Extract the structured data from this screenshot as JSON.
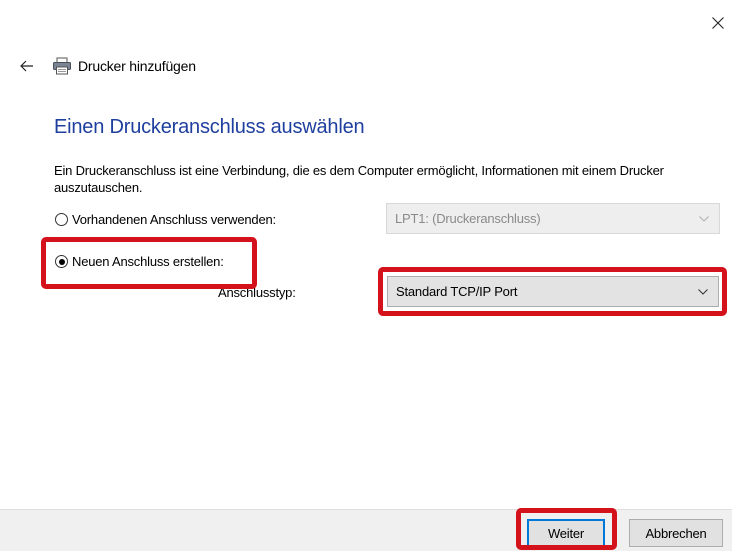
{
  "header": {
    "close_icon": "close-icon",
    "back_icon": "back-arrow-icon",
    "printer_icon": "printer-icon",
    "title": "Drucker hinzufügen"
  },
  "main": {
    "page_title": "Einen Druckeranschluss auswählen",
    "description": "Ein Druckeranschluss ist eine Verbindung, die es dem Computer ermöglicht, Informationen mit einem Drucker auszutauschen.",
    "existing_port": {
      "label": "Vorhandenen Anschluss verwenden:",
      "selected": false,
      "value": "LPT1: (Druckeranschluss)",
      "enabled": false
    },
    "new_port": {
      "label": "Neuen Anschluss erstellen:",
      "selected": true,
      "type_label": "Anschlusstyp:",
      "type_value": "Standard TCP/IP Port"
    }
  },
  "footer": {
    "next_label": "Weiter",
    "cancel_label": "Abbrechen"
  },
  "colors": {
    "title_blue": "#1f3f9e",
    "highlight_red": "#d4121c",
    "focus_blue": "#0078d7"
  }
}
